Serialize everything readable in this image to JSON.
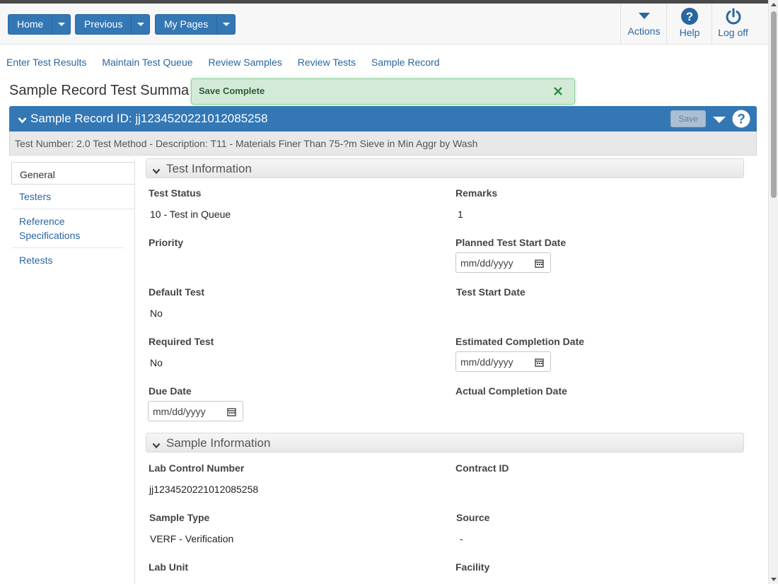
{
  "header": {
    "buttons": [
      {
        "label": "Home"
      },
      {
        "label": "Previous"
      },
      {
        "label": "My Pages"
      }
    ],
    "actions": [
      {
        "label": "Actions",
        "icon": "caret-down-icon"
      },
      {
        "label": "Help",
        "icon": "help-circle-icon"
      },
      {
        "label": "Log off",
        "icon": "power-icon"
      }
    ]
  },
  "nav": {
    "links": [
      "Enter Test Results",
      "Maintain Test Queue",
      "Review Samples",
      "Review Tests",
      "Sample Record"
    ]
  },
  "page": {
    "title": "Sample Record Test Summa"
  },
  "toast": {
    "message": "Save Complete"
  },
  "record": {
    "title": "Sample Record ID: jj1234520221012085258",
    "save_label": "Save",
    "subheader": "Test Number: 2.0 Test Method - Description: T11 - Materials Finer Than 75-?m Sieve in Min Aggr by Wash"
  },
  "side_tabs": [
    "General",
    "Testers",
    "Reference Specifications",
    "Retests"
  ],
  "test_info": {
    "title": "Test Information",
    "test_status_label": "Test Status",
    "test_status_value": "10 - Test in Queue",
    "remarks_label": "Remarks",
    "remarks_value": "1",
    "priority_label": "Priority",
    "planned_start_label": "Planned Test Start Date",
    "default_test_label": "Default Test",
    "default_test_value": "No",
    "test_start_label": "Test Start Date",
    "required_test_label": "Required Test",
    "required_test_value": "No",
    "est_completion_label": "Estimated Completion Date",
    "due_date_label": "Due Date",
    "actual_completion_label": "Actual Completion Date",
    "date_placeholder": "mm/dd/yyyy"
  },
  "sample_info": {
    "title": "Sample Information",
    "lab_control_label": "Lab Control Number",
    "lab_control_value": "jj1234520221012085258",
    "contract_label": "Contract ID",
    "sample_type_label": "Sample Type",
    "sample_type_value": "VERF - Verification",
    "source_label": "Source",
    "source_value": "-",
    "lab_unit_label": "Lab Unit",
    "facility_label": "Facility"
  },
  "colors": {
    "primary": "#3477b5",
    "link": "#2a66a0",
    "toast_bg": "#d3ead7",
    "toast_text": "#2c5e36"
  }
}
